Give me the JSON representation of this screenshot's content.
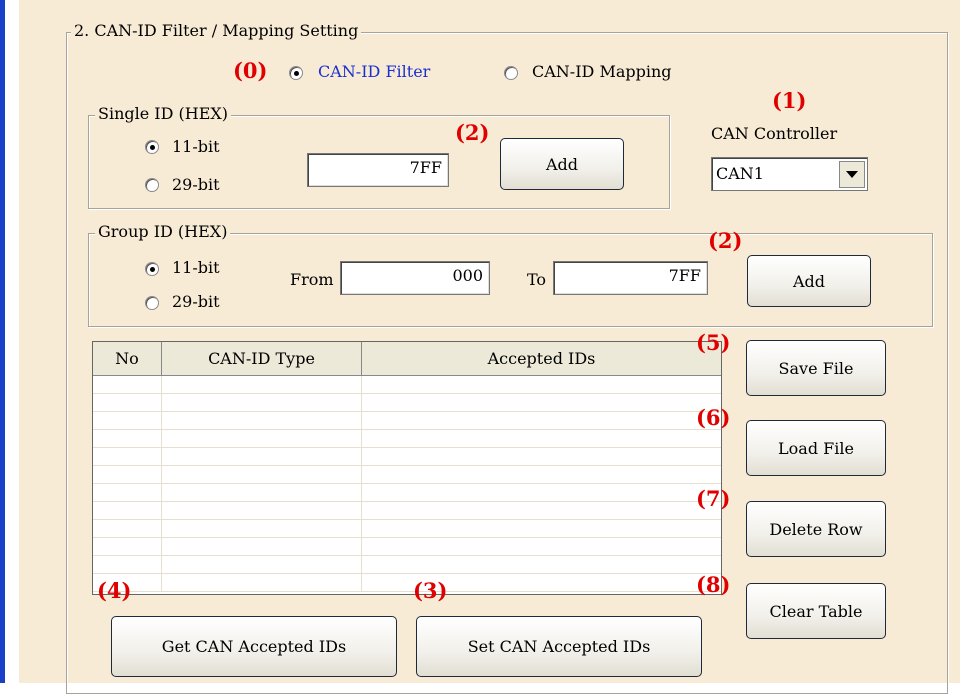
{
  "group_title": "2. CAN-ID Filter / Mapping Setting",
  "annotations": {
    "mode": "(0)",
    "controller": "(1)",
    "single_add": "(2)",
    "group_add": "(2)",
    "set_ids": "(3)",
    "get_ids": "(4)",
    "save_file": "(5)",
    "load_file": "(6)",
    "delete_row": "(7)",
    "clear_table": "(8)"
  },
  "mode": {
    "options": [
      "CAN-ID Filter",
      "CAN-ID Mapping"
    ],
    "selected": "CAN-ID Filter"
  },
  "single_id": {
    "title": "Single ID (HEX)",
    "options": [
      "11-bit",
      "29-bit"
    ],
    "selected": "11-bit",
    "value": "7FF",
    "add_label": "Add"
  },
  "controller": {
    "label": "CAN Controller",
    "value": "CAN1"
  },
  "group_id": {
    "title": "Group ID (HEX)",
    "options": [
      "11-bit",
      "29-bit"
    ],
    "selected": "11-bit",
    "from_label": "From",
    "from_value": "000",
    "to_label": "To",
    "to_value": "7FF",
    "add_label": "Add"
  },
  "table": {
    "columns": [
      "No",
      "CAN-ID Type",
      "Accepted IDs"
    ],
    "rows": []
  },
  "buttons": {
    "save_file": "Save File",
    "load_file": "Load File",
    "delete_row": "Delete Row",
    "clear_table": "Clear Table",
    "get_ids": "Get CAN Accepted IDs",
    "set_ids": "Set CAN Accepted IDs"
  },
  "colors": {
    "panel": "#f7ebd6",
    "accent_blue": "#1a3fc8",
    "annotation_red": "#e00000",
    "selected_option_text": "#1a2fd0"
  }
}
